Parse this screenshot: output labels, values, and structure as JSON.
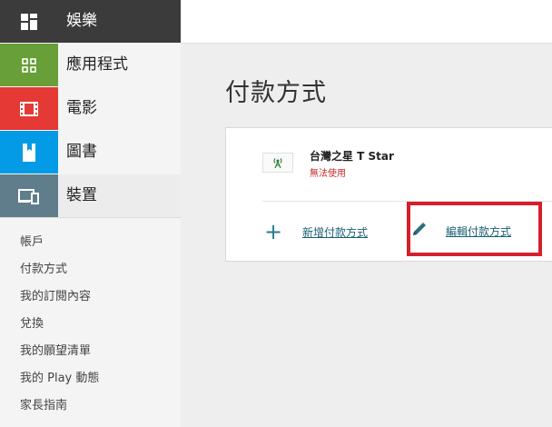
{
  "sidebar": {
    "top": {
      "label": "娛樂",
      "icon": "entertainment-grid-icon"
    },
    "categories": [
      {
        "label": "應用程式",
        "icon": "apps-grid-icon",
        "color": "#689f38"
      },
      {
        "label": "電影",
        "icon": "film-strip-icon",
        "color": "#e53935"
      },
      {
        "label": "圖書",
        "icon": "book-icon",
        "color": "#039be5"
      },
      {
        "label": "裝置",
        "icon": "devices-icon",
        "color": "#607d8b"
      }
    ],
    "links": [
      "帳戶",
      "付款方式",
      "我的訂閱內容",
      "兌換",
      "我的願望清單",
      "我的 Play 動態",
      "家長指南"
    ]
  },
  "main": {
    "title": "付款方式",
    "payment_method": {
      "name": "台灣之星 T Star",
      "status": "無法使用",
      "status_color": "#c62828",
      "icon": "cell-tower-icon"
    },
    "actions": {
      "add_label": "新增付款方式",
      "edit_label": "編輯付款方式"
    }
  }
}
